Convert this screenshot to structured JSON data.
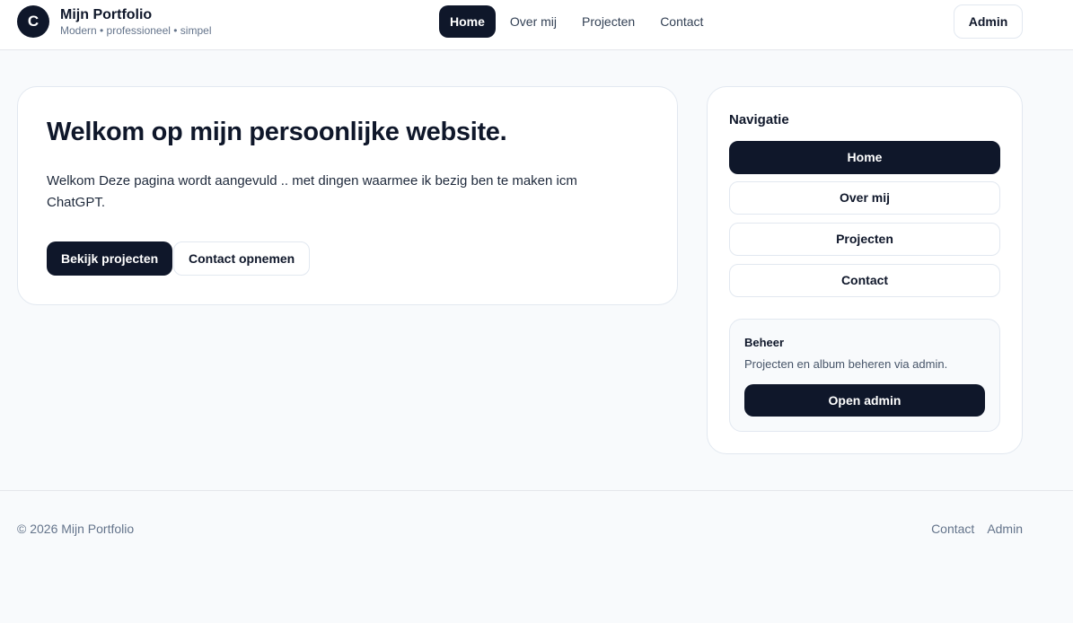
{
  "brand": {
    "logo_letter": "C",
    "title": "Mijn Portfolio",
    "tagline": "Modern • professioneel • simpel"
  },
  "nav": {
    "items": [
      "Home",
      "Over mij",
      "Projecten",
      "Contact"
    ],
    "active": "Home",
    "admin_label": "Admin"
  },
  "hero": {
    "heading": "Welkom op mijn persoonlijke website.",
    "text": "Welkom Deze pagina wordt aangevuld .. met dingen waarmee ik bezig ben te maken icm ChatGPT.",
    "primary_button": "Bekijk projecten",
    "secondary_button": "Contact opnemen"
  },
  "sidebar": {
    "title": "Navigatie",
    "items": [
      "Home",
      "Over mij",
      "Projecten",
      "Contact"
    ],
    "beheer": {
      "title": "Beheer",
      "description": "Projecten en album beheren via admin.",
      "button": "Open admin"
    }
  },
  "footer": {
    "copyright": "© 2026 Mijn Portfolio",
    "links": [
      "Contact",
      "Admin"
    ]
  },
  "colors": {
    "primary": "#0f172a",
    "background": "#f8fafc",
    "border": "#e2e8f0",
    "muted_text": "#64748b"
  }
}
